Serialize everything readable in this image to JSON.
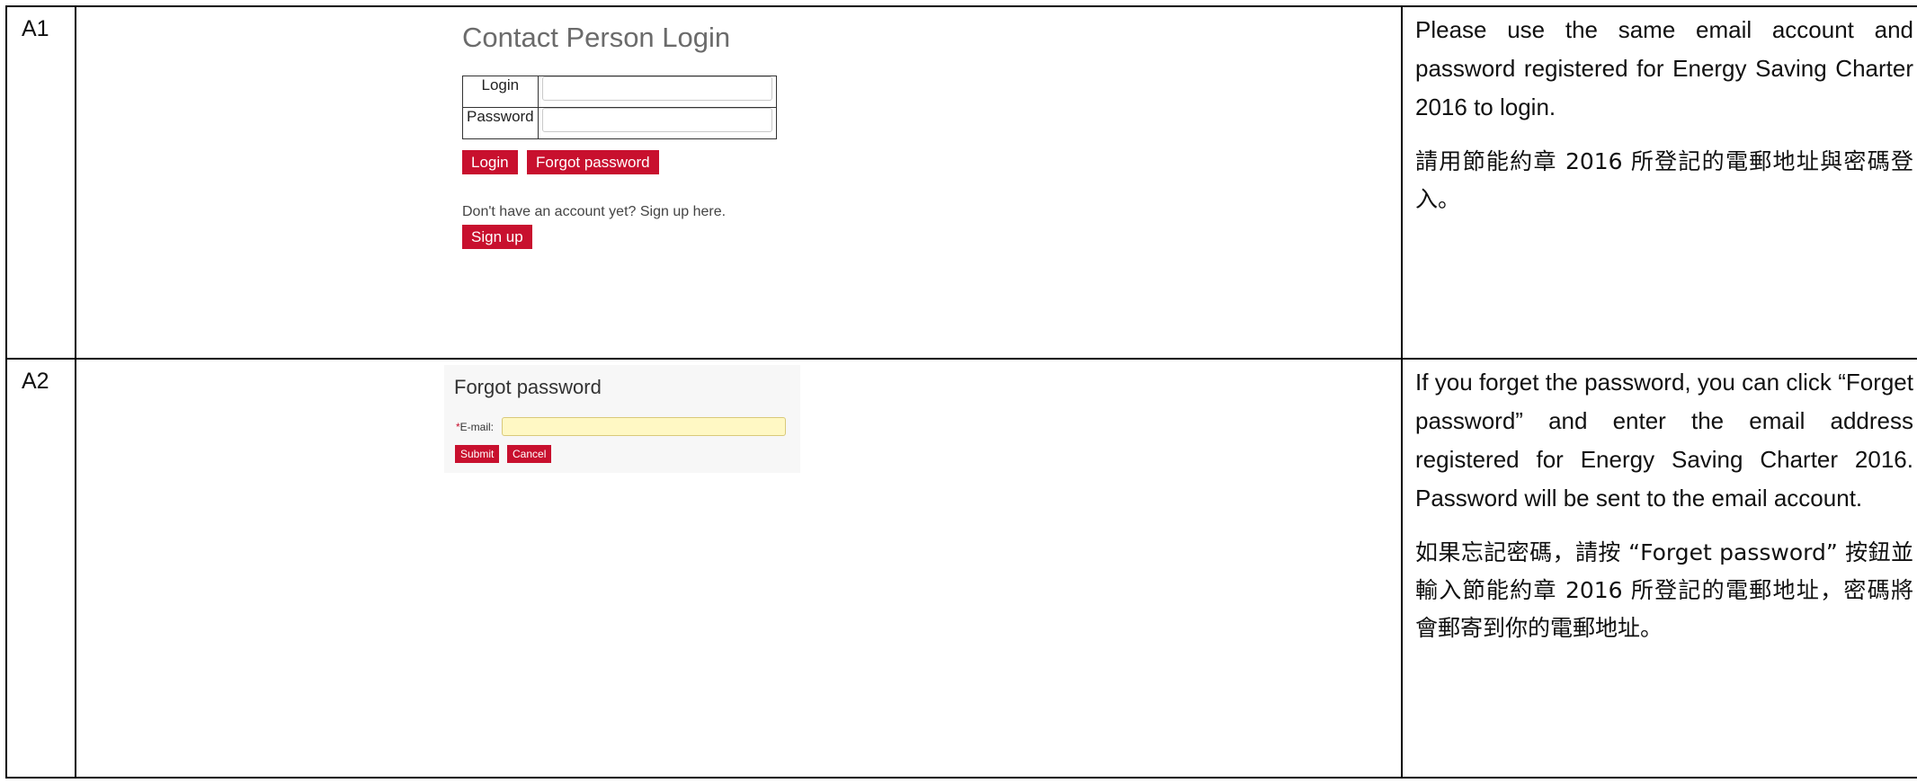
{
  "rows": [
    {
      "id": "A1",
      "screenshot": {
        "title": "Contact Person Login",
        "login_label": "Login",
        "password_label": "Password",
        "login_button": "Login",
        "forgot_button": "Forgot password",
        "no_account_text": "Don't have an account yet? Sign up here.",
        "signup_button": "Sign up"
      },
      "notes_en": "Please use the same email account and password registered for Energy Saving Charter 2016 to login.",
      "notes_zh": "請用節能約章 2016 所登記的電郵地址與密碼登入。"
    },
    {
      "id": "A2",
      "screenshot": {
        "title": "Forgot password",
        "required_mark": "*",
        "email_label": "E-mail:",
        "submit_button": "Submit",
        "cancel_button": "Cancel"
      },
      "notes_en": "If you forget the password, you can click “Forget password” and enter the email address registered for Energy Saving Charter 2016.   Password will be sent to the email account.",
      "notes_zh": "如果忘記密碼，請按 “Forget password” 按鈕並輸入節能約章 2016 所登記的電郵地址，密碼將會郵寄到你的電郵地址。"
    }
  ]
}
